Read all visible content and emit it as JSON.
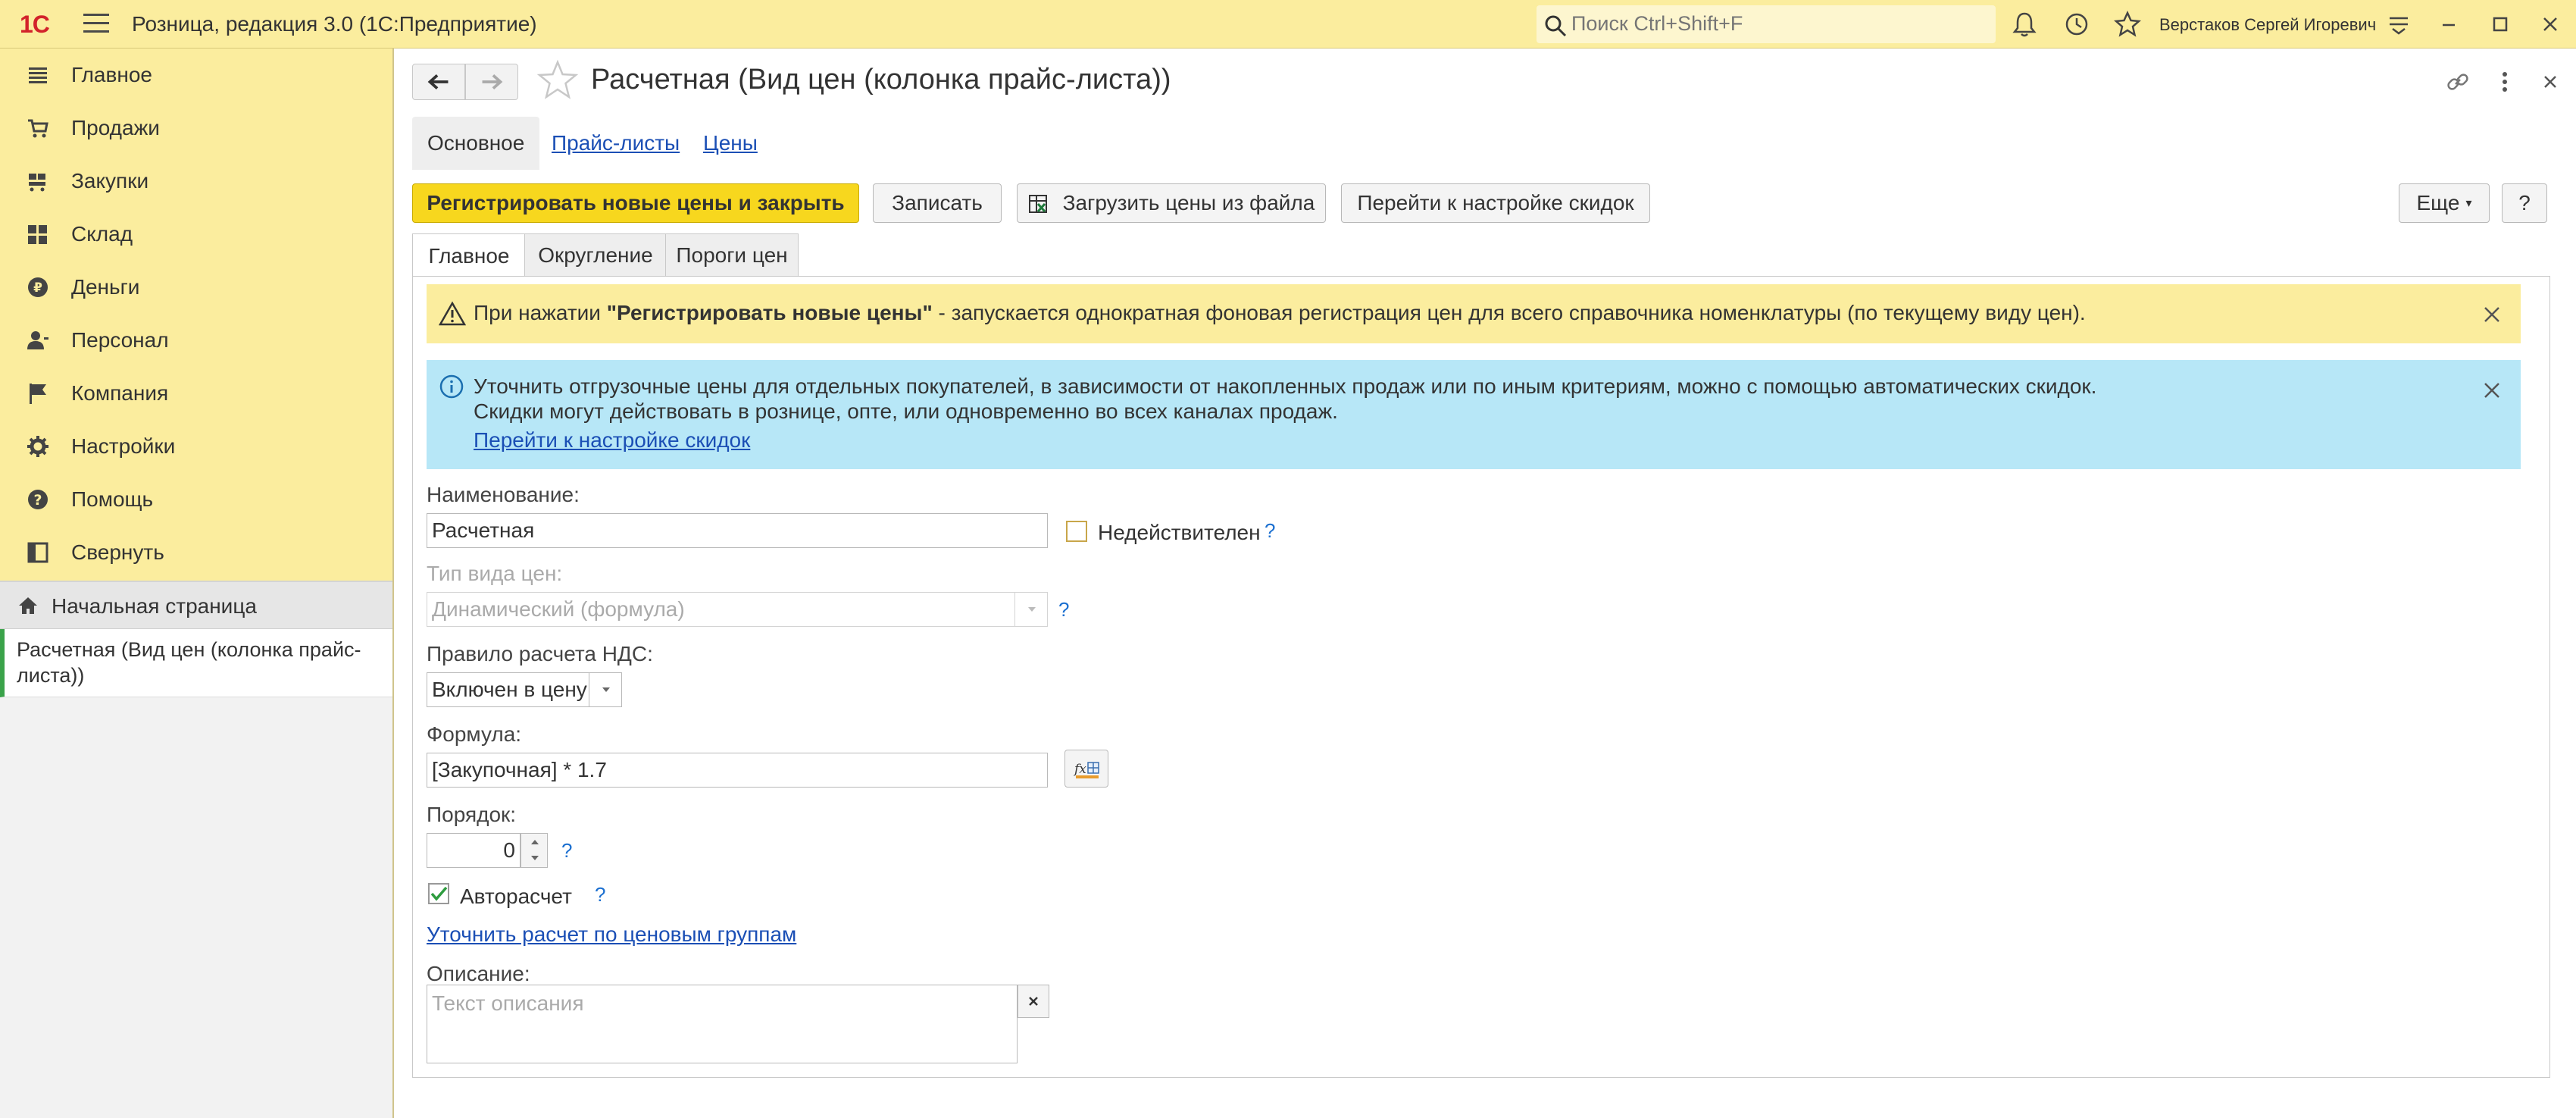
{
  "titlebar": {
    "logo": "1С",
    "app_title": "Розница, редакция 3.0  (1С:Предприятие)",
    "search_placeholder": "Поиск Ctrl+Shift+F",
    "username": "Верстаков Сергей Игоревич"
  },
  "sidebar": {
    "items": [
      {
        "label": "Главное",
        "icon": "list-icon"
      },
      {
        "label": "Продажи",
        "icon": "cart-icon"
      },
      {
        "label": "Закупки",
        "icon": "purchase-icon"
      },
      {
        "label": "Склад",
        "icon": "warehouse-icon"
      },
      {
        "label": "Деньги",
        "icon": "money-icon"
      },
      {
        "label": "Персонал",
        "icon": "person-icon"
      },
      {
        "label": "Компания",
        "icon": "flag-icon"
      },
      {
        "label": "Настройки",
        "icon": "gear-icon"
      },
      {
        "label": "Помощь",
        "icon": "help-icon"
      },
      {
        "label": "Свернуть",
        "icon": "collapse-icon"
      }
    ],
    "home": "Начальная страница",
    "open_form": "Расчетная (Вид цен (колонка прайс-листа))"
  },
  "form": {
    "title": "Расчетная (Вид цен (колонка прайс-листа))",
    "section_tabs": [
      "Основное",
      "Прайс-листы",
      "Цены"
    ],
    "buttons": {
      "register": "Регистрировать новые цены и закрыть",
      "save": "Записать",
      "load": "Загрузить цены из файла",
      "discounts": "Перейти к настройке скидок",
      "more": "Еще",
      "help": "?"
    },
    "tabs": [
      "Главное",
      "Округление",
      "Пороги цен"
    ],
    "warning": {
      "prefix": "При нажатии ",
      "bold": "\"Регистрировать новые цены\"",
      "suffix": " - запускается однократная фоновая регистрация цен для всего справочника номенклатуры (по текущему виду цен)."
    },
    "info": {
      "line1": "Уточнить отгрузочные цены для отдельных покупателей, в зависимости от накопленных продаж или по иным критериям, можно с помощью автоматических скидок.",
      "line2": "Скидки могут действовать в рознице, опте, или одновременно во всех каналах продаж.",
      "link": "Перейти к настройке скидок"
    },
    "fields": {
      "name_label": "Наименование:",
      "name_value": "Расчетная",
      "invalid_label": "Недействителен",
      "price_type_label": "Тип вида цен:",
      "price_type_value": "Динамический (формула)",
      "vat_label": "Правило расчета НДС:",
      "vat_value": "Включен в цену",
      "formula_label": "Формула:",
      "formula_value": "[Закупочная] * 1.7",
      "order_label": "Порядок:",
      "order_value": "0",
      "autocalc_label": "Авторасчет",
      "refine_link": "Уточнить расчет по ценовым группам",
      "description_label": "Описание:",
      "description_placeholder": "Текст описания",
      "hint": "?"
    }
  },
  "colors": {
    "titlebar_bg": "#fbed9e",
    "primary_button": "#f7d71e",
    "info_bg": "#b7e7f7",
    "link": "#1b4fb5",
    "active_marker": "#3aa34a"
  }
}
